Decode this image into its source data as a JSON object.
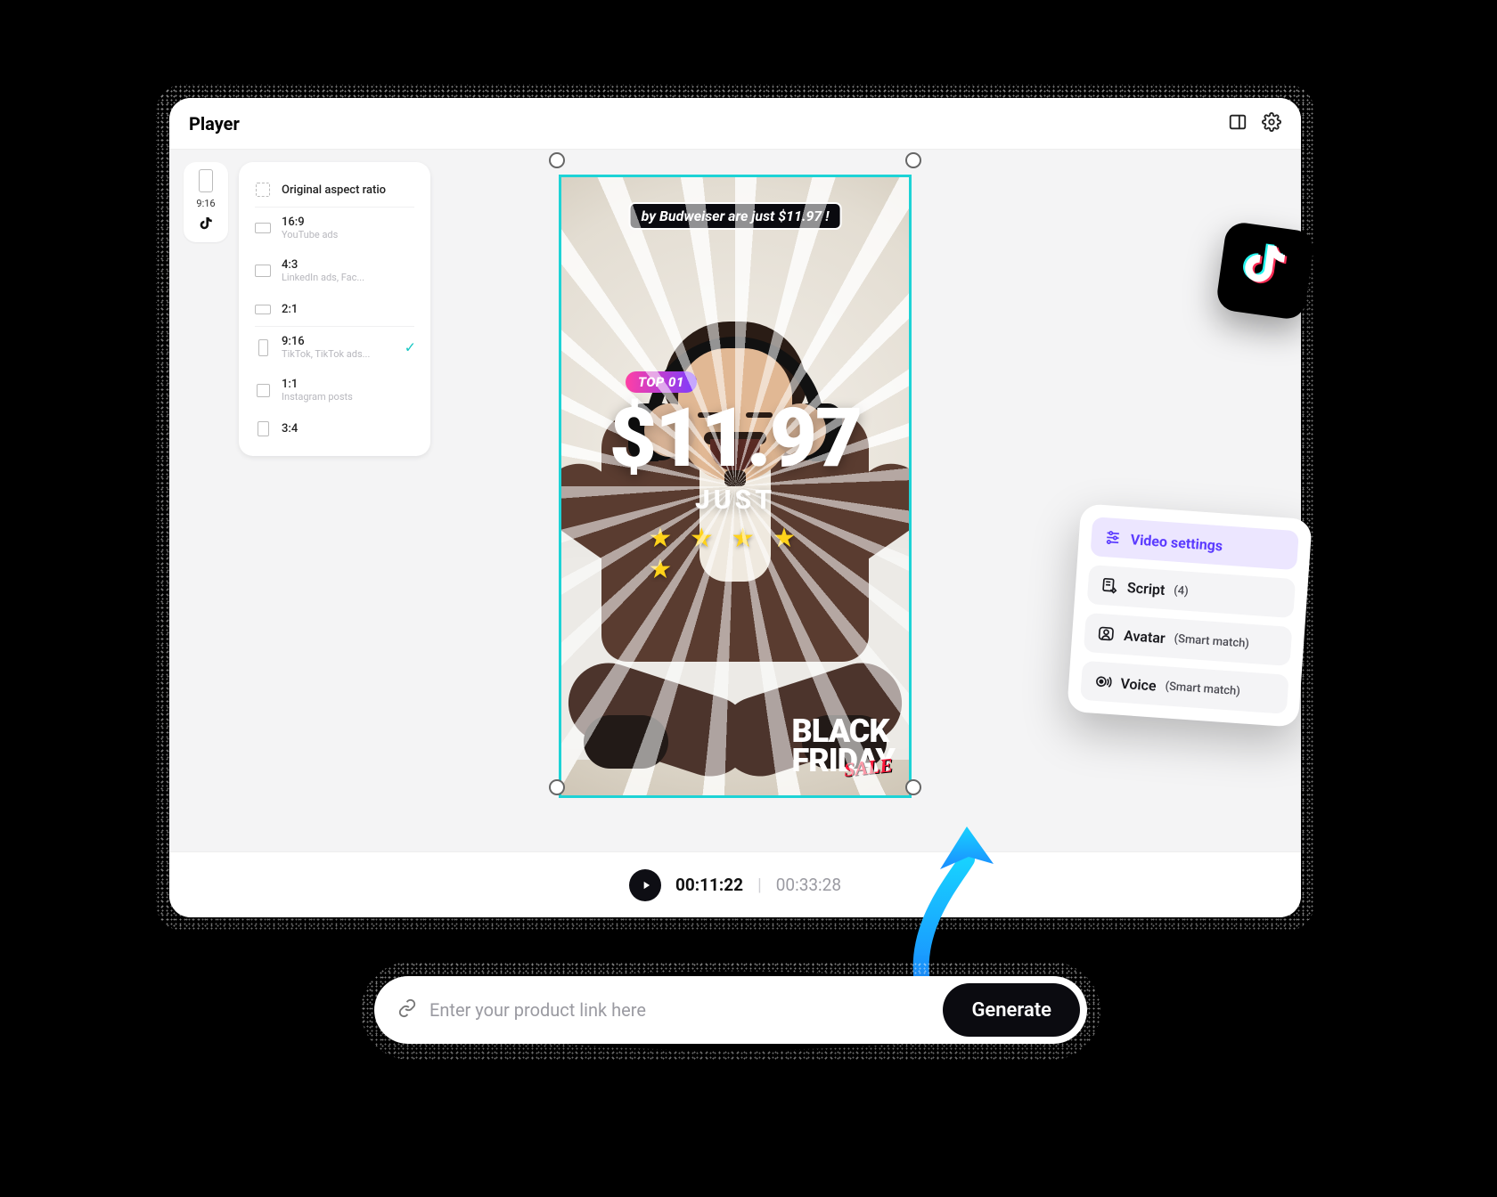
{
  "header": {
    "title": "Player"
  },
  "rail": {
    "label": "9:16"
  },
  "aspect_ratios": {
    "original": {
      "label": "Original aspect ratio"
    },
    "r169": {
      "label": "16:9",
      "sub": "YouTube ads"
    },
    "r43": {
      "label": "4:3",
      "sub": "LinkedIn ads, Fac..."
    },
    "r21": {
      "label": "2:1"
    },
    "r916": {
      "label": "9:16",
      "sub": "TikTok, TikTok ads..."
    },
    "r11": {
      "label": "1:1",
      "sub": "Instagram posts"
    },
    "r34": {
      "label": "3:4"
    }
  },
  "preview": {
    "caption": "by Budweiser are just $11.97 !",
    "badge": "TOP 01",
    "price": "$11.97",
    "just": "JUST",
    "stars": "★ ★ ★ ★ ★",
    "bf_line1": "BLACK",
    "bf_line2": "FRIDAY",
    "bf_sale": "SALE"
  },
  "playback": {
    "current": "00:11:22",
    "sep": "|",
    "duration": "00:33:28"
  },
  "settings": {
    "video_settings": "Video settings",
    "script_label": "Script",
    "script_count": "(4)",
    "avatar_label": "Avatar",
    "avatar_sub": "(Smart match)",
    "voice_label": "Voice",
    "voice_sub": "(Smart match)"
  },
  "generate": {
    "placeholder": "Enter your product link here",
    "button": "Generate"
  }
}
